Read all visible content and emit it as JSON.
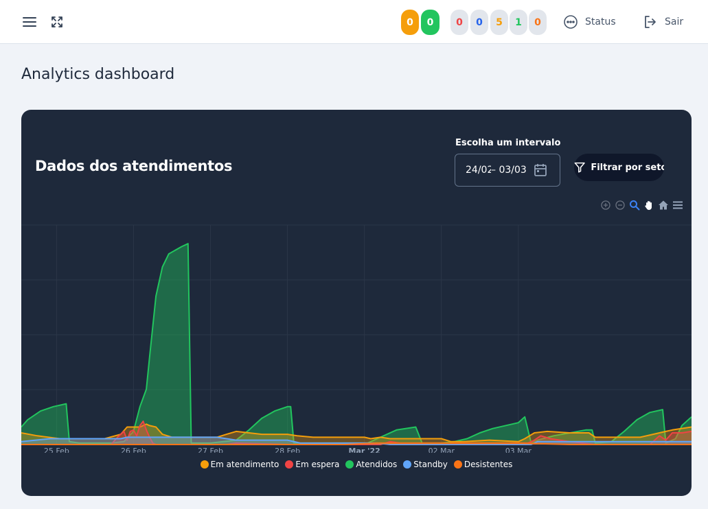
{
  "header": {
    "menu_icon": "hamburger-menu-icon",
    "fullscreen_icon": "expand-icon",
    "solid_badges": [
      {
        "value": "0",
        "color": "#f59e0b"
      },
      {
        "value": "0",
        "color": "#22c55e"
      }
    ],
    "counter_badges": [
      {
        "value": "0",
        "color": "#ef4444"
      },
      {
        "value": "0",
        "color": "#2563eb"
      },
      {
        "value": "5",
        "color": "#f59e0b"
      },
      {
        "value": "1",
        "color": "#22c55e"
      },
      {
        "value": "0",
        "color": "#f97316"
      }
    ],
    "status_label": "Status",
    "logout_label": "Sair"
  },
  "page": {
    "title": "Analytics dashboard"
  },
  "card": {
    "title": "Dados dos atendimentos",
    "range_label": "Escolha um intervalo",
    "range_start": "24/02",
    "range_end": "– 03/03",
    "filter_label": "Filtrar por setor",
    "toolbar_icons": [
      "zoom-in-icon",
      "zoom-out-icon",
      "selection-zoom-icon",
      "pan-hand-icon",
      "reset-home-icon",
      "menu-icon"
    ]
  },
  "chart_data": {
    "type": "area",
    "x_labels": [
      "25 Feb",
      "26 Feb",
      "27 Feb",
      "28 Feb",
      "Mar '22",
      "02 Mar",
      "03 Mar"
    ],
    "x_label_bold": "Mar '22",
    "x_domain_hours": [
      -11,
      198
    ],
    "series": [
      {
        "name": "Em atendimento",
        "color": "#f59e0b",
        "points": [
          [
            -11,
            8
          ],
          [
            -6,
            6
          ],
          [
            1,
            4
          ],
          [
            2,
            4
          ],
          [
            7,
            4
          ],
          [
            15,
            4
          ],
          [
            20,
            7
          ],
          [
            22,
            12
          ],
          [
            24,
            12
          ],
          [
            26,
            12
          ],
          [
            28,
            14
          ],
          [
            29,
            13
          ],
          [
            31,
            12
          ],
          [
            33,
            7
          ],
          [
            36,
            5
          ],
          [
            48,
            5
          ],
          [
            50,
            5
          ],
          [
            53,
            7
          ],
          [
            56,
            9
          ],
          [
            60,
            8
          ],
          [
            64,
            7
          ],
          [
            72,
            7
          ],
          [
            75,
            6
          ],
          [
            80,
            5
          ],
          [
            96,
            5
          ],
          [
            98,
            4
          ],
          [
            101,
            5
          ],
          [
            104,
            4
          ],
          [
            110,
            4
          ],
          [
            120,
            4
          ],
          [
            123,
            2
          ],
          [
            127,
            2
          ],
          [
            135,
            3
          ],
          [
            144,
            2
          ],
          [
            146,
            4
          ],
          [
            149,
            8
          ],
          [
            153,
            9
          ],
          [
            160,
            8
          ],
          [
            166,
            8
          ],
          [
            168,
            5
          ],
          [
            176,
            5
          ],
          [
            182,
            5
          ],
          [
            186,
            7
          ],
          [
            190,
            9
          ],
          [
            192,
            10
          ],
          [
            198,
            12
          ]
        ]
      },
      {
        "name": "Em espera",
        "color": "#ef4444",
        "points": [
          [
            -11,
            0
          ],
          [
            17,
            0
          ],
          [
            19,
            5
          ],
          [
            21,
            9
          ],
          [
            22,
            3
          ],
          [
            23,
            9
          ],
          [
            24,
            10
          ],
          [
            25,
            6
          ],
          [
            26,
            13
          ],
          [
            27,
            16
          ],
          [
            28,
            10
          ],
          [
            29,
            5
          ],
          [
            30,
            1
          ],
          [
            31,
            0
          ],
          [
            53,
            0
          ],
          [
            56,
            1
          ],
          [
            72,
            0
          ],
          [
            101,
            0
          ],
          [
            104,
            2
          ],
          [
            107,
            1
          ],
          [
            116,
            0
          ],
          [
            124,
            0
          ],
          [
            125,
            1
          ],
          [
            140,
            1
          ],
          [
            147,
            1
          ],
          [
            149,
            3
          ],
          [
            151,
            6
          ],
          [
            154,
            4
          ],
          [
            160,
            2
          ],
          [
            168,
            0
          ],
          [
            185,
            0
          ],
          [
            188,
            6
          ],
          [
            190,
            3
          ],
          [
            192,
            8
          ],
          [
            195,
            8
          ],
          [
            198,
            9
          ]
        ]
      },
      {
        "name": "Atendidos",
        "color": "#22c55e",
        "points": [
          [
            -11,
            12
          ],
          [
            -9,
            17
          ],
          [
            -5,
            23
          ],
          [
            -1,
            26
          ],
          [
            3,
            28
          ],
          [
            4,
            2
          ],
          [
            7,
            1
          ],
          [
            13,
            1
          ],
          [
            17,
            1
          ],
          [
            21,
            2
          ],
          [
            24,
            9
          ],
          [
            26,
            26
          ],
          [
            28,
            38
          ],
          [
            29,
            60
          ],
          [
            31,
            102
          ],
          [
            33,
            122
          ],
          [
            35,
            131
          ],
          [
            39,
            136
          ],
          [
            41,
            138
          ],
          [
            42,
            1
          ],
          [
            48,
            1
          ],
          [
            56,
            3
          ],
          [
            60,
            10
          ],
          [
            64,
            18
          ],
          [
            68,
            23
          ],
          [
            72,
            26
          ],
          [
            73,
            26
          ],
          [
            74,
            1
          ],
          [
            88,
            1
          ],
          [
            97,
            1
          ],
          [
            101,
            5
          ],
          [
            106,
            10
          ],
          [
            112,
            12
          ],
          [
            114,
            1
          ],
          [
            120,
            1
          ],
          [
            124,
            2
          ],
          [
            128,
            4
          ],
          [
            132,
            8
          ],
          [
            136,
            11
          ],
          [
            144,
            15
          ],
          [
            146,
            19
          ],
          [
            148,
            1
          ],
          [
            150,
            3
          ],
          [
            155,
            6
          ],
          [
            165,
            10
          ],
          [
            167,
            10
          ],
          [
            168,
            1
          ],
          [
            173,
            2
          ],
          [
            177,
            9
          ],
          [
            181,
            17
          ],
          [
            185,
            22
          ],
          [
            189,
            24
          ],
          [
            190,
            1
          ],
          [
            193,
            4
          ],
          [
            195,
            13
          ],
          [
            198,
            19
          ]
        ]
      },
      {
        "name": "Standby",
        "color": "#60a5fa",
        "points": [
          [
            -11,
            2
          ],
          [
            -2,
            4
          ],
          [
            20,
            4
          ],
          [
            22,
            5
          ],
          [
            50,
            5
          ],
          [
            56,
            3
          ],
          [
            72,
            3
          ],
          [
            76,
            1
          ],
          [
            100,
            1
          ],
          [
            104,
            0
          ],
          [
            148,
            0
          ],
          [
            150,
            2
          ],
          [
            198,
            2
          ]
        ]
      },
      {
        "name": "Desistentes",
        "color": "#f97316",
        "points": [
          [
            -11,
            0
          ],
          [
            90,
            0
          ],
          [
            100,
            1
          ],
          [
            110,
            1
          ],
          [
            144,
            1
          ],
          [
            160,
            0
          ],
          [
            198,
            0
          ]
        ]
      }
    ],
    "ylim": [
      0,
      140
    ],
    "grid": true,
    "legend_position": "bottom",
    "toolbar_icons": [
      "zoom-in-icon",
      "zoom-out-icon",
      "selection-zoom-icon",
      "pan-hand-icon",
      "reset-home-icon",
      "menu-icon"
    ]
  }
}
